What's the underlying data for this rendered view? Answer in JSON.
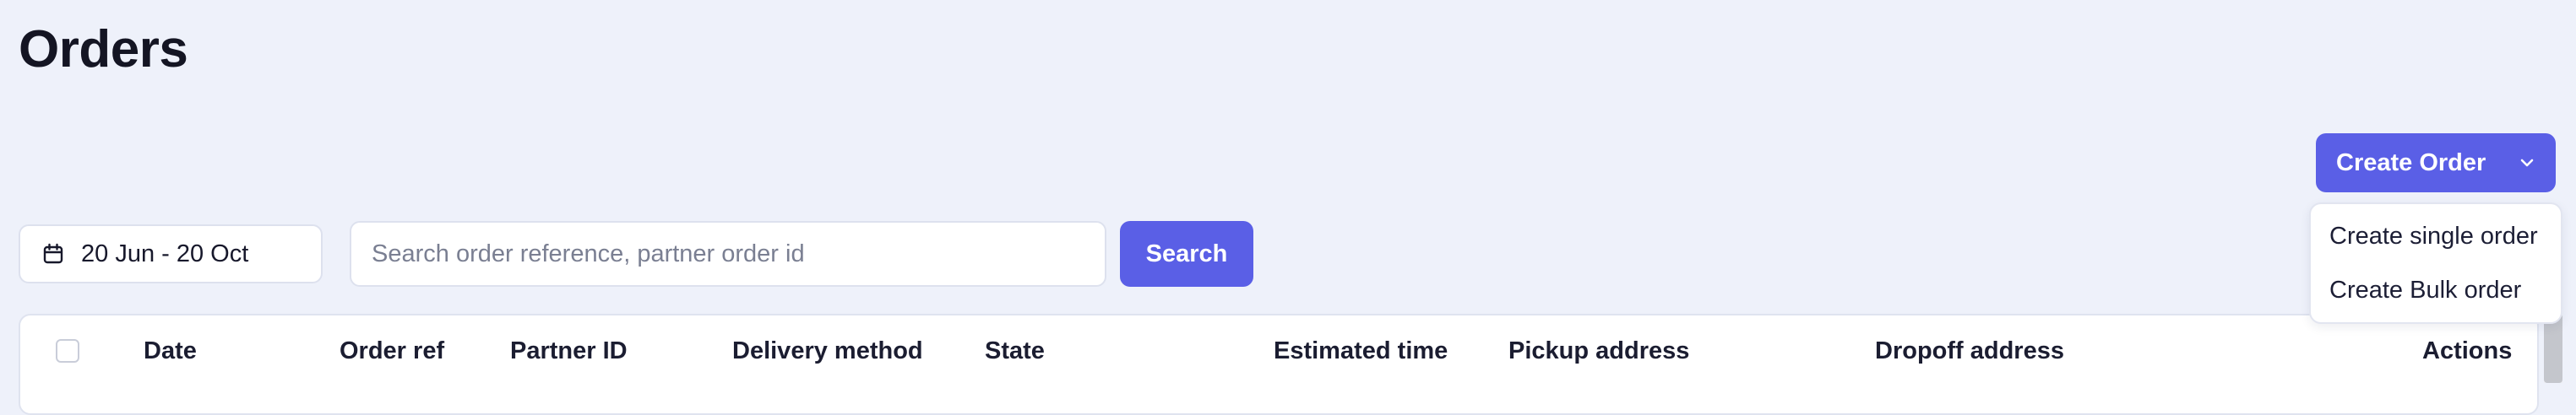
{
  "page": {
    "title": "Orders"
  },
  "toolbar": {
    "create_order_label": "Create Order",
    "create_order_menu": [
      "Create single order",
      "Create Bulk order"
    ]
  },
  "filters": {
    "date_range": "20 Jun - 20 Oct",
    "search_placeholder": "Search order reference, partner order id",
    "search_value": "",
    "search_button_label": "Search"
  },
  "table": {
    "columns": [
      "Date",
      "Order ref",
      "Partner ID",
      "Delivery method",
      "State",
      "Estimated time",
      "Pickup address",
      "Dropoff address",
      "Actions"
    ],
    "select_all_checked": false
  },
  "icons": {
    "date_picker": "calendar-icon",
    "create_order_toggle": "chevron-down-icon"
  },
  "colors": {
    "page_background": "#eef1fa",
    "accent": "#5a5fe6",
    "text": "#17182b",
    "border": "#dde1ee"
  }
}
